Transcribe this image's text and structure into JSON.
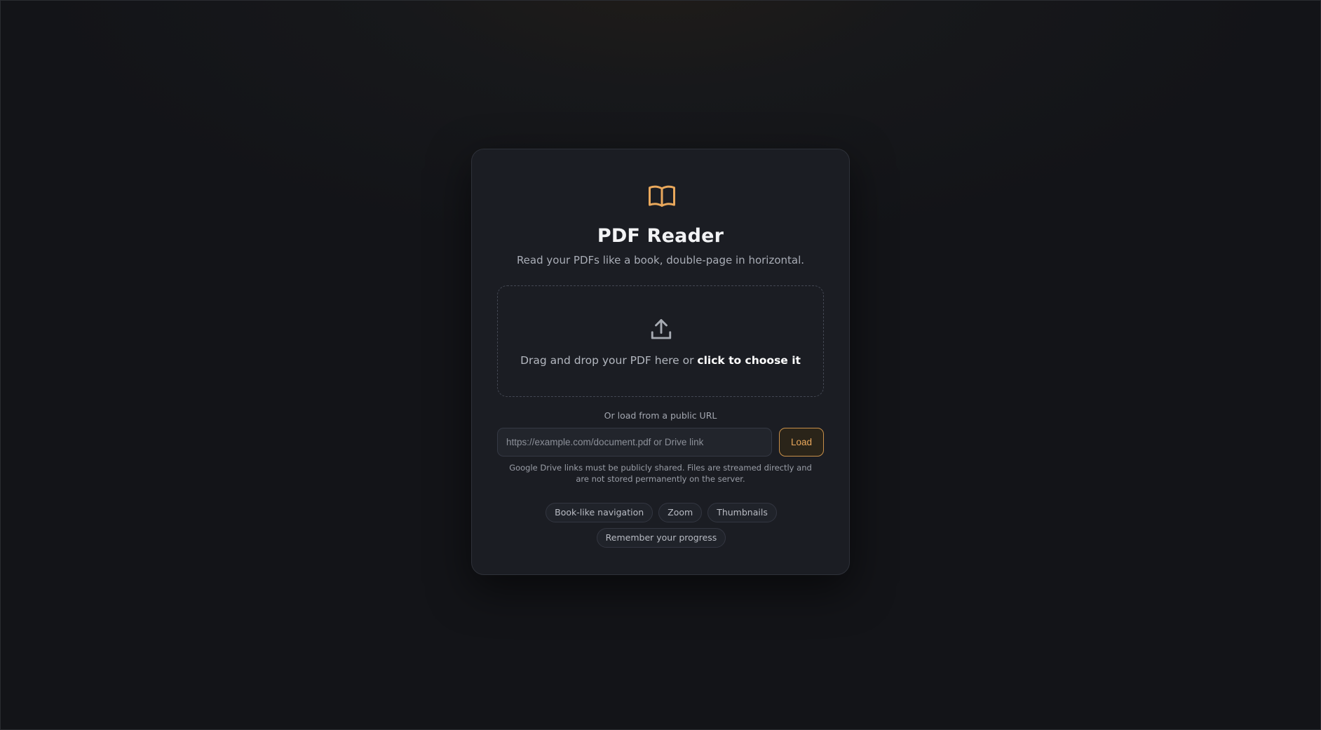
{
  "app": {
    "title": "PDF Reader",
    "subtitle": "Read your PDFs like a book, double-page in horizontal.",
    "logo_icon": "open-book-icon",
    "accent_color": "#e9a85c"
  },
  "dropzone": {
    "icon": "upload-icon",
    "text": "Drag and drop your PDF here or ",
    "action_text": "click to choose it"
  },
  "url_loader": {
    "label": "Or load from a public URL",
    "input_value": "",
    "placeholder": "https://example.com/document.pdf or Drive link",
    "button_label": "Load",
    "note": "Google Drive links must be publicly shared. Files are streamed directly and are not stored permanently on the server."
  },
  "features": [
    "Book-like navigation",
    "Zoom",
    "Thumbnails",
    "Remember your progress"
  ]
}
